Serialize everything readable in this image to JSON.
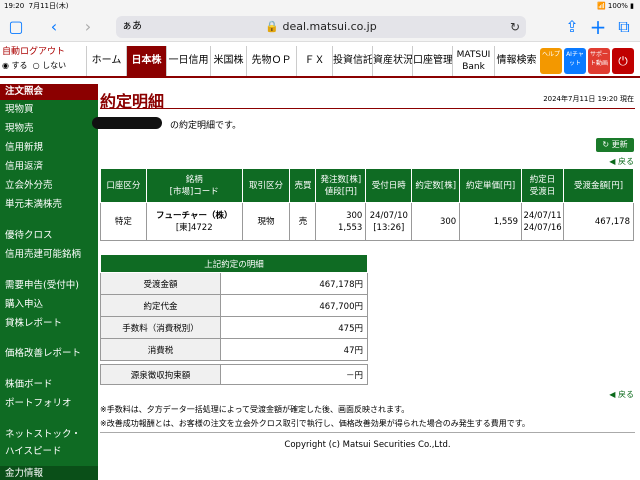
{
  "status_bar": {
    "time": "19:20",
    "date": "7月11日(木)",
    "battery": "100%"
  },
  "browser": {
    "text_size": "ぁあ",
    "url": "deal.matsui.co.jp"
  },
  "nav": {
    "auto_logout": "自動ログアウト",
    "option_on": "する",
    "option_off": "しない",
    "items": [
      "ホーム",
      "日本株",
      "一日信用",
      "米国株",
      "先物ＯＰ",
      "ＦＸ",
      "投資信託",
      "資産状況",
      "口座管理",
      "MATSUI Bank",
      "情報検索"
    ],
    "icons": [
      {
        "label": "ヘルプ",
        "color": "#f39800"
      },
      {
        "label": "AIチャット",
        "color": "#0a7aff"
      },
      {
        "label": "サポート動画",
        "color": "#e03c31"
      },
      {
        "label": "",
        "color": "#c00000"
      }
    ]
  },
  "sidebar": {
    "items": [
      "注文照会",
      "現物買",
      "現物売",
      "信用新規",
      "信用返済",
      "立会外分売",
      "単元未満株売",
      "優待クロス",
      "信用売建可能銘柄",
      "需要申告(受付中)",
      "購入申込",
      "貸株レポート",
      "価格改善レポート",
      "株価ボード",
      "ポートフォリオ",
      "ネットストック・",
      "ハイスピード",
      "金力情報"
    ]
  },
  "page": {
    "title": "約定明細",
    "datetime": "2024年7月11日 19:20 現在",
    "message": "の約定明細です。",
    "update_label": "更新",
    "back_label": "戻る"
  },
  "exec_table": {
    "headers": [
      "口座区分",
      "銘柄\n[市場]コード",
      "取引区分",
      "売買",
      "発注数[株]\n値段[円]",
      "受付日時",
      "約定数[株]",
      "約定単価[円]",
      "約定日\n受渡日",
      "受渡金額[円]"
    ],
    "row": {
      "account": "特定",
      "name": "フューチャー（株）",
      "market": "[東]4722",
      "trade_type": "現物",
      "side": "売",
      "order_qty": "300",
      "order_price": "1,553",
      "recv_date": "24/07/10",
      "recv_time": "[13:26]",
      "exec_qty": "300",
      "exec_price": "1,559",
      "exec_date": "24/07/11",
      "settle_date": "24/07/16",
      "amount": "467,178"
    }
  },
  "summary": {
    "title": "上記約定の明細",
    "rows": [
      {
        "label": "受渡金額",
        "value": "467,178円"
      },
      {
        "label": "約定代金",
        "value": "467,700円"
      },
      {
        "label": "手数料（消費税別）",
        "value": "475円"
      },
      {
        "label": "消費税",
        "value": "47円"
      }
    ]
  },
  "withholding": {
    "label": "源泉徴収拘束額",
    "value": "－円"
  },
  "notes": [
    "※手数料は、夕方データ一括処理によって受渡金額が確定した後、画面反映されます。",
    "※改善成功報酬とは、お客様の注文を立会外クロス取引で執行し、価格改善効果が得られた場合のみ発生する費用です。"
  ],
  "copyright": "Copyright (c) Matsui Securities Co.,Ltd."
}
